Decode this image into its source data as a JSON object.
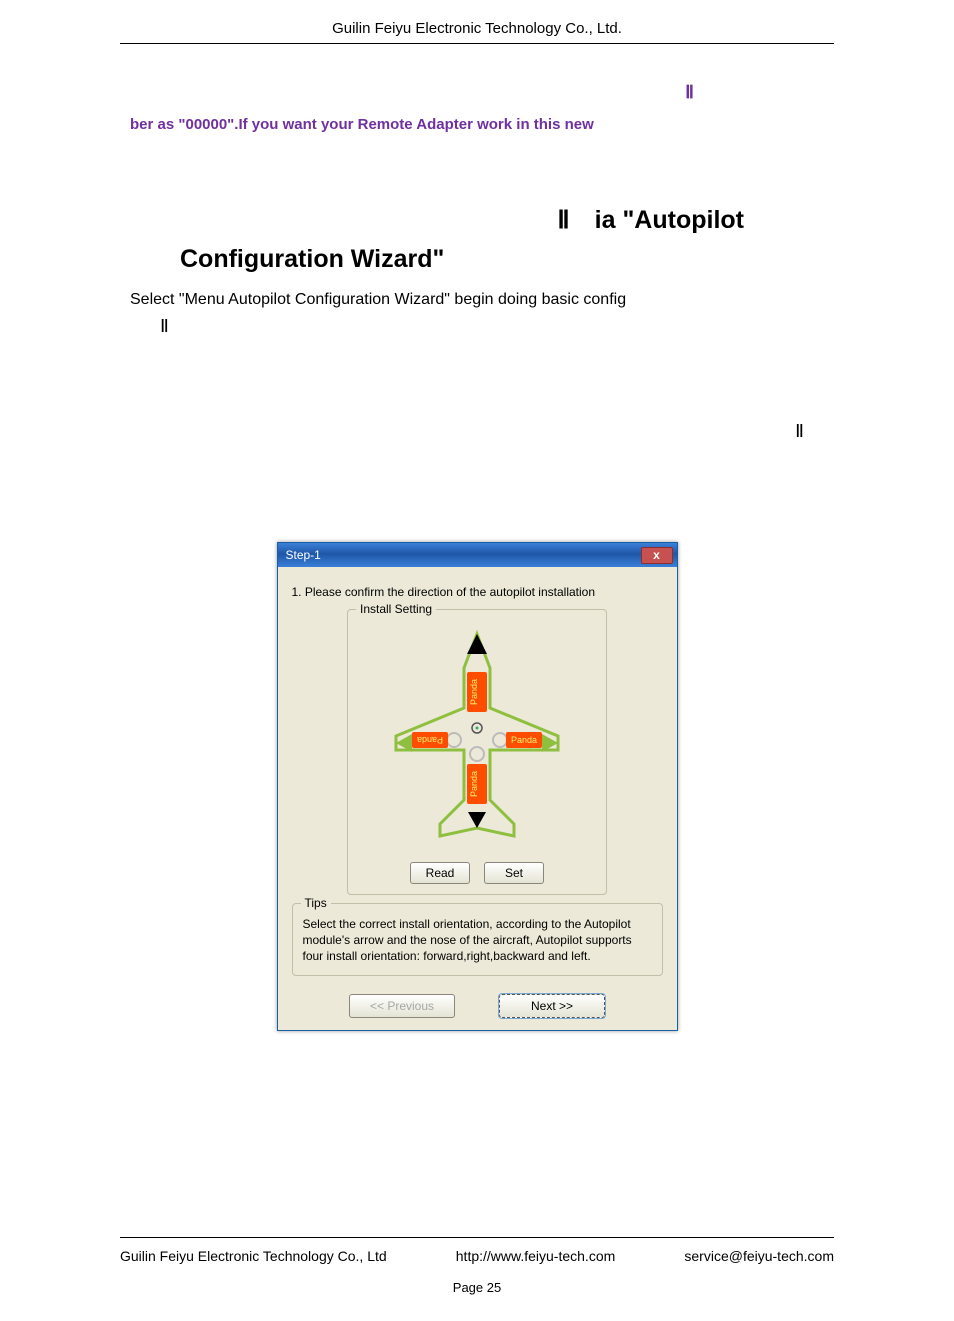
{
  "header": {
    "title": "Guilin Feiyu Electronic Technology Co., Ltd."
  },
  "purple": {
    "pi_right": "Ⅱ",
    "line2": "ber as \"00000\".If you want your    Remote Adapter work in this new"
  },
  "heading": {
    "row1_pi": "Ⅱ",
    "row1_rest": "ia \"Autopilot",
    "row2": "Configuration Wizard\""
  },
  "para": {
    "text": "Select \"Menu    Autopilot Configuration Wizard\" begin doing basic config"
  },
  "pis": {
    "below": "Ⅱ",
    "right": "Ⅱ"
  },
  "dialog": {
    "title": "Step-1",
    "close": "x",
    "step_label": "1. Please confirm the direction of the autopilot installation",
    "install_title": "Install Setting",
    "panda_fwd": "Panda",
    "panda_back": "Panda",
    "panda_left": "Panda",
    "panda_right": "Panda",
    "read_btn": "Read",
    "set_btn": "Set",
    "tips_title": "Tips",
    "tips_text": "Select the correct install orientation, according to the Autopilot module's arrow and the nose of the aircraft, Autopilot supports four install orientation: forward,right,backward and left.",
    "prev_btn": "<<  Previous",
    "next_btn": "Next   >>"
  },
  "footer": {
    "company": "Guilin Feiyu Electronic Technology Co., Ltd",
    "url": "http://www.feiyu-tech.com",
    "email": "service@feiyu-tech.com",
    "page": "Page 25"
  }
}
